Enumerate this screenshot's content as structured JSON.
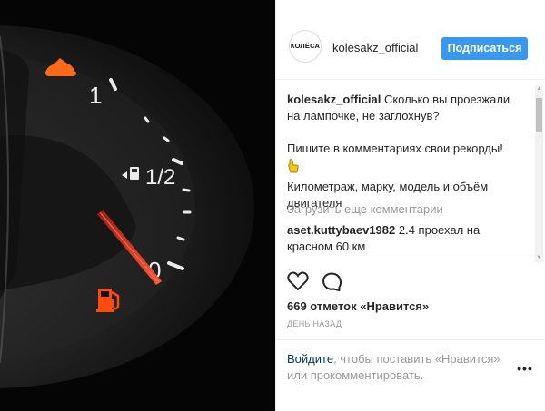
{
  "header": {
    "avatar_text": "КОЛЁСА",
    "username": "kolesakz_official",
    "follow_label": "Подписаться"
  },
  "caption": {
    "username": "kolesakz_official",
    "text": "Сколько вы проезжали на лампочке, не заглохнув?",
    "line2": "Пишите в комментариях свои рекорды!",
    "emoji_icon": "pointing-hand-icon",
    "line3": "Километраж, марку, модель и объём двигателя"
  },
  "load_more": "Загрузить еще комментарии",
  "comment": {
    "username": "aset.kuttybaev1982",
    "text": "2.4 проехал на красном 60 км"
  },
  "actions": {
    "like_icon": "heart-icon",
    "comment_icon": "comment-icon",
    "likes_text": "669 отметок «Нравится»",
    "timestamp": "день назад"
  },
  "add_comment": {
    "login_link": "Войдите",
    "login_rest": ", чтобы поставить «Нравится» или прокомментировать.",
    "more_label": "•••"
  },
  "gauge": {
    "top_label": "1",
    "mid_label": "1/2",
    "bottom_label": "0",
    "needle_fraction": 0.0,
    "hood_icon": "car-hood-icon",
    "pump_icon": "fuel-pump-icon",
    "warning_icon": "low-fuel-warning-icon",
    "colors": {
      "warning": "#ff4a10",
      "needle": "#e6392a",
      "gauge_face": "#2b2b2b"
    }
  }
}
